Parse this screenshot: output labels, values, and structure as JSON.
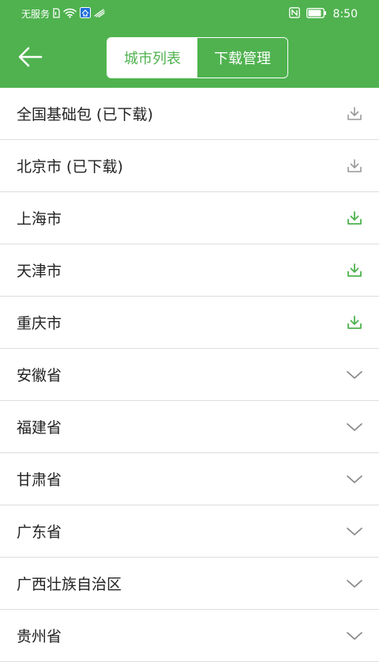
{
  "status_bar": {
    "carrier": "无服务",
    "time": "8:50"
  },
  "header": {
    "back_icon": "arrow-left-icon",
    "tabs": [
      {
        "label": "城市列表",
        "active": false
      },
      {
        "label": "下载管理",
        "active": true
      }
    ]
  },
  "colors": {
    "brand_green": "#4fb24f",
    "gray_icon": "#999999",
    "text": "#222222"
  },
  "list": {
    "items": [
      {
        "label": "全国基础包 (已下载)",
        "icon": "download-icon",
        "status": "downloaded"
      },
      {
        "label": "北京市 (已下载)",
        "icon": "download-icon",
        "status": "downloaded"
      },
      {
        "label": "上海市",
        "icon": "download-icon",
        "status": "available"
      },
      {
        "label": "天津市",
        "icon": "download-icon",
        "status": "available"
      },
      {
        "label": "重庆市",
        "icon": "download-icon",
        "status": "available"
      },
      {
        "label": "安徽省",
        "icon": "chevron-down-icon",
        "status": "expandable"
      },
      {
        "label": "福建省",
        "icon": "chevron-down-icon",
        "status": "expandable"
      },
      {
        "label": "甘肃省",
        "icon": "chevron-down-icon",
        "status": "expandable"
      },
      {
        "label": "广东省",
        "icon": "chevron-down-icon",
        "status": "expandable"
      },
      {
        "label": "广西壮族自治区",
        "icon": "chevron-down-icon",
        "status": "expandable"
      },
      {
        "label": "贵州省",
        "icon": "chevron-down-icon",
        "status": "expandable"
      }
    ]
  }
}
